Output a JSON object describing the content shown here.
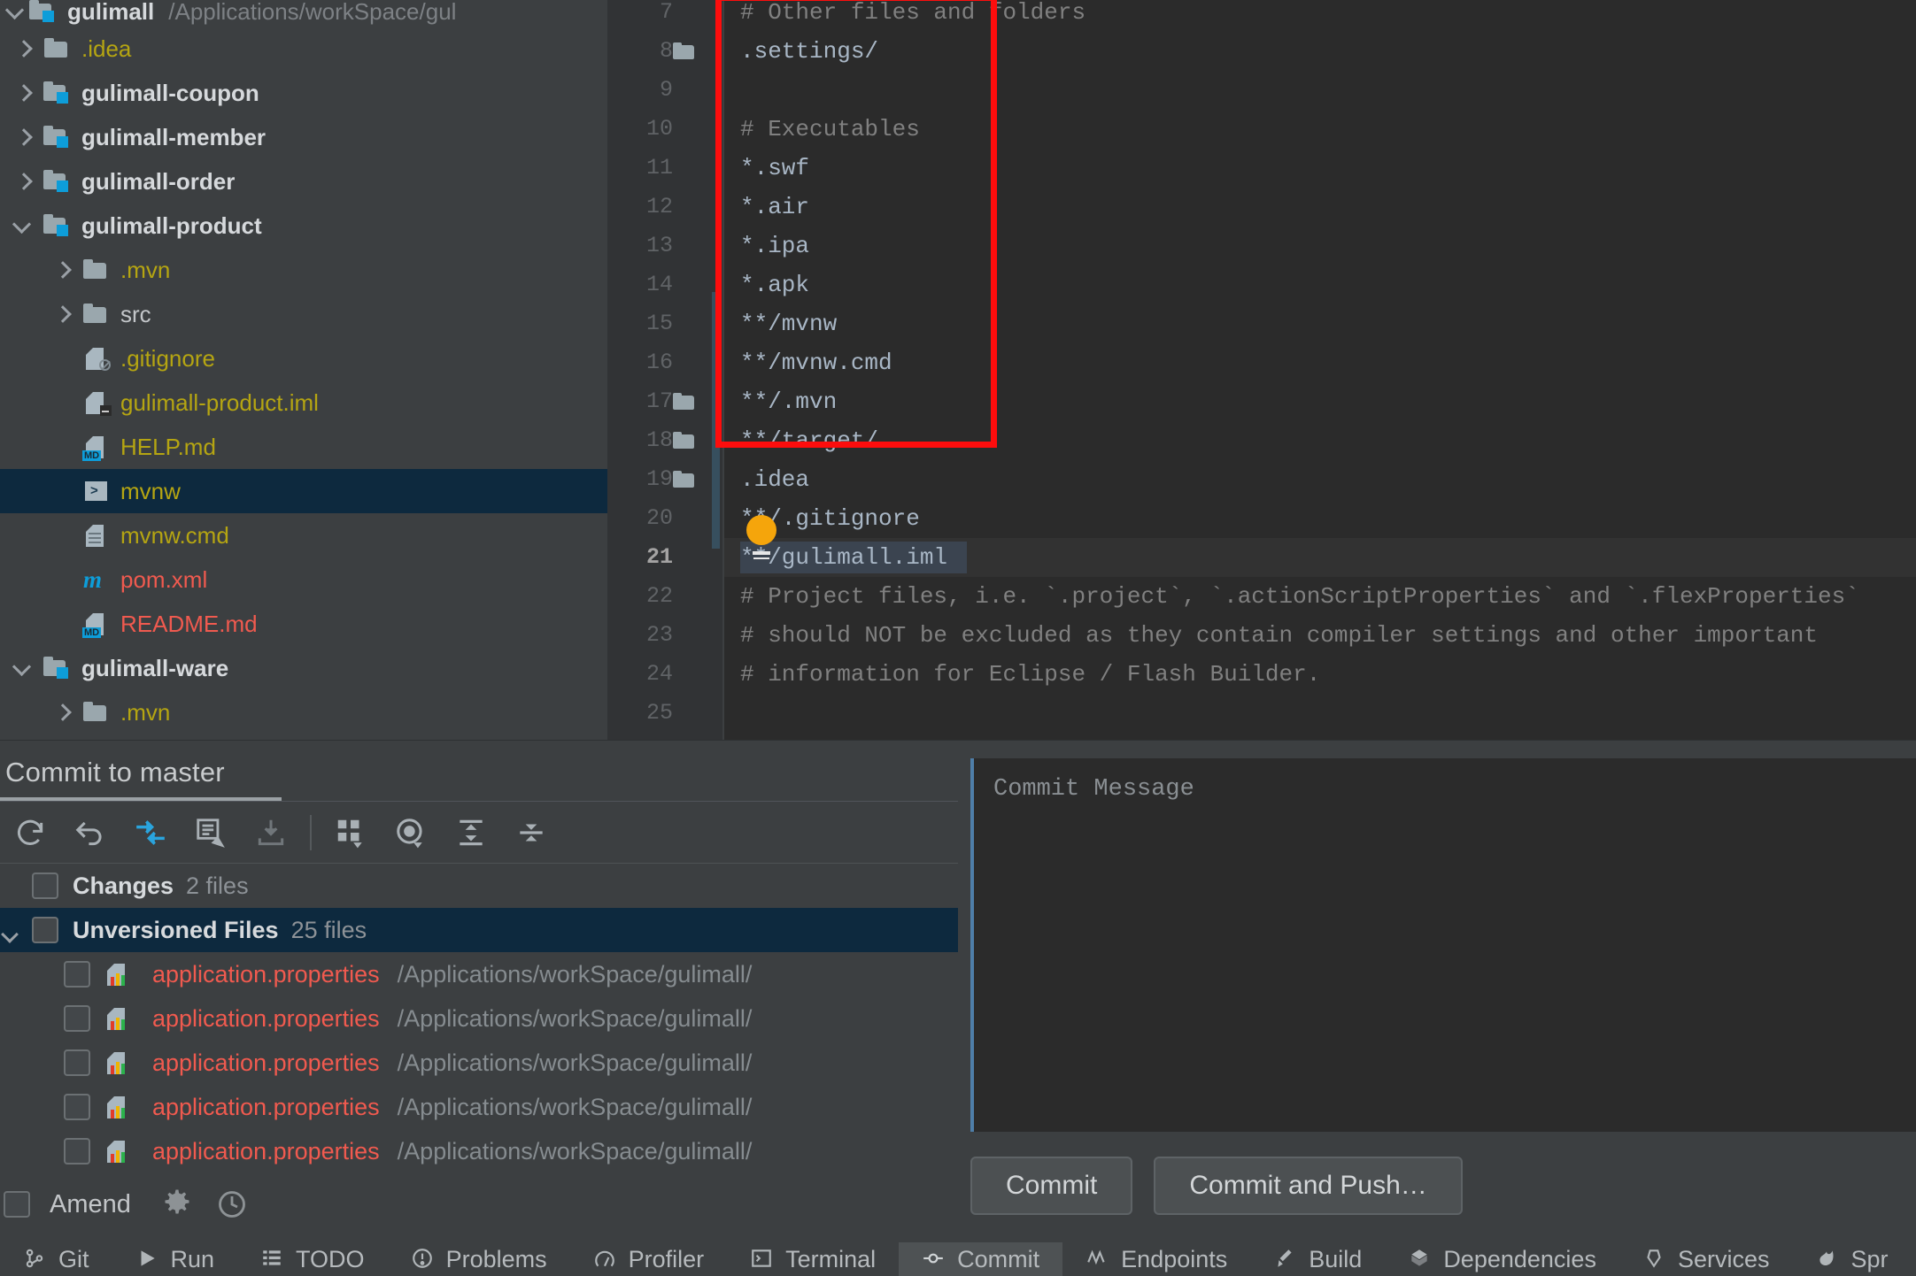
{
  "project": {
    "name": "gulimall",
    "path": "/Applications/workSpace/gul",
    "tree": [
      {
        "label": ".idea",
        "kind": "folder",
        "indent": 1,
        "arrow": "right",
        "color": "yellow",
        "selected": false
      },
      {
        "label": "gulimall-coupon",
        "kind": "module",
        "indent": 1,
        "arrow": "right",
        "color": "bold",
        "selected": false
      },
      {
        "label": "gulimall-member",
        "kind": "module",
        "indent": 1,
        "arrow": "right",
        "color": "bold",
        "selected": false
      },
      {
        "label": "gulimall-order",
        "kind": "module",
        "indent": 1,
        "arrow": "right",
        "color": "bold",
        "selected": false
      },
      {
        "label": "gulimall-product",
        "kind": "module",
        "indent": 1,
        "arrow": "down",
        "color": "bold",
        "selected": false
      },
      {
        "label": ".mvn",
        "kind": "folder",
        "indent": 2,
        "arrow": "right",
        "color": "yellow",
        "selected": false
      },
      {
        "label": "src",
        "kind": "folder",
        "indent": 2,
        "arrow": "right",
        "color": "white",
        "selected": false
      },
      {
        "label": ".gitignore",
        "kind": "gitignore",
        "indent": 2,
        "arrow": "none",
        "color": "yellow",
        "selected": false
      },
      {
        "label": "gulimall-product.iml",
        "kind": "iml",
        "indent": 2,
        "arrow": "none",
        "color": "yellow",
        "selected": false
      },
      {
        "label": "HELP.md",
        "kind": "md",
        "indent": 2,
        "arrow": "none",
        "color": "yellow",
        "selected": false
      },
      {
        "label": "mvnw",
        "kind": "shell",
        "indent": 2,
        "arrow": "none",
        "color": "yellow",
        "selected": true
      },
      {
        "label": "mvnw.cmd",
        "kind": "text",
        "indent": 2,
        "arrow": "none",
        "color": "yellow",
        "selected": false
      },
      {
        "label": "pom.xml",
        "kind": "maven",
        "indent": 2,
        "arrow": "none",
        "color": "red",
        "selected": false
      },
      {
        "label": "README.md",
        "kind": "md",
        "indent": 2,
        "arrow": "none",
        "color": "red",
        "selected": false
      },
      {
        "label": "gulimall-ware",
        "kind": "module",
        "indent": 1,
        "arrow": "down",
        "color": "bold",
        "selected": false
      },
      {
        "label": ".mvn",
        "kind": "folder",
        "indent": 2,
        "arrow": "right",
        "color": "yellow",
        "selected": false
      }
    ]
  },
  "editor": {
    "lines": [
      {
        "num": 7,
        "text": "# Other files and folders",
        "comment": true,
        "fold": false,
        "current": false
      },
      {
        "num": 8,
        "text": ".settings/",
        "comment": false,
        "fold": true,
        "current": false
      },
      {
        "num": 9,
        "text": "",
        "comment": false,
        "fold": false,
        "current": false
      },
      {
        "num": 10,
        "text": "# Executables",
        "comment": true,
        "fold": false,
        "current": false
      },
      {
        "num": 11,
        "text": "*.swf",
        "comment": false,
        "fold": false,
        "current": false
      },
      {
        "num": 12,
        "text": "*.air",
        "comment": false,
        "fold": false,
        "current": false
      },
      {
        "num": 13,
        "text": "*.ipa",
        "comment": false,
        "fold": false,
        "current": false
      },
      {
        "num": 14,
        "text": "*.apk",
        "comment": false,
        "fold": false,
        "current": false
      },
      {
        "num": 15,
        "text": "**/mvnw",
        "comment": false,
        "fold": false,
        "current": false
      },
      {
        "num": 16,
        "text": "**/mvnw.cmd",
        "comment": false,
        "fold": false,
        "current": false
      },
      {
        "num": 17,
        "text": "**/.mvn",
        "comment": false,
        "fold": true,
        "current": false
      },
      {
        "num": 18,
        "text": "**/target/",
        "comment": false,
        "fold": true,
        "current": false
      },
      {
        "num": 19,
        "text": ".idea",
        "comment": false,
        "fold": true,
        "current": false
      },
      {
        "num": 20,
        "text": "**/.gitignore",
        "comment": false,
        "fold": false,
        "current": false
      },
      {
        "num": 21,
        "text": "**/gulimall.iml",
        "comment": false,
        "fold": false,
        "current": true
      },
      {
        "num": 22,
        "text": "# Project files, i.e. `.project`, `.actionScriptProperties` and `.flexProperties`",
        "comment": true,
        "fold": false,
        "current": false
      },
      {
        "num": 23,
        "text": "# should NOT be excluded as they contain compiler settings and other important",
        "comment": true,
        "fold": false,
        "current": false
      },
      {
        "num": 24,
        "text": "# information for Eclipse / Flash Builder.",
        "comment": true,
        "fold": false,
        "current": false
      },
      {
        "num": 25,
        "text": "",
        "comment": false,
        "fold": false,
        "current": false
      }
    ],
    "annotation": {
      "highlight_color": "#fd0d0d",
      "intention_icon": "lightbulb-icon"
    }
  },
  "commit": {
    "title": "Commit to master",
    "toolbar": [
      {
        "name": "refresh-changes-icon"
      },
      {
        "name": "rollback-icon"
      },
      {
        "name": "show-diff-icon"
      },
      {
        "name": "group-by-icon"
      },
      {
        "name": "shelve-silently-icon"
      },
      {
        "name": "group-layout-icon"
      },
      {
        "name": "preview-diff-icon"
      },
      {
        "name": "expand-all-icon"
      },
      {
        "name": "collapse-all-icon"
      }
    ],
    "groups": [
      {
        "label": "Changes",
        "count": "2 files",
        "selected": false,
        "twisty": false
      },
      {
        "label": "Unversioned Files",
        "count": "25 files",
        "selected": true,
        "twisty": true
      }
    ],
    "files": [
      {
        "name": "application.properties",
        "path": "/Applications/workSpace/gulimall/"
      },
      {
        "name": "application.properties",
        "path": "/Applications/workSpace/gulimall/"
      },
      {
        "name": "application.properties",
        "path": "/Applications/workSpace/gulimall/"
      },
      {
        "name": "application.properties",
        "path": "/Applications/workSpace/gulimall/"
      },
      {
        "name": "application.properties",
        "path": "/Applications/workSpace/gulimall/"
      }
    ],
    "amend_label": "Amend",
    "amend_icons": [
      {
        "name": "gear-icon"
      },
      {
        "name": "history-clock-icon"
      }
    ],
    "message_placeholder": "Commit Message",
    "buttons": [
      {
        "label": "Commit",
        "name": "commit-button"
      },
      {
        "label": "Commit and Push…",
        "name": "commit-and-push-button"
      }
    ]
  },
  "statusbar": {
    "items": [
      {
        "label": "Git",
        "icon": "git-icon",
        "active": false
      },
      {
        "label": "Run",
        "icon": "run-icon",
        "active": false
      },
      {
        "label": "TODO",
        "icon": "todo-icon",
        "active": false
      },
      {
        "label": "Problems",
        "icon": "problems-icon",
        "active": false
      },
      {
        "label": "Profiler",
        "icon": "profiler-icon",
        "active": false
      },
      {
        "label": "Terminal",
        "icon": "terminal-icon",
        "active": false
      },
      {
        "label": "Commit",
        "icon": "commit-icon",
        "active": true
      },
      {
        "label": "Endpoints",
        "icon": "endpoints-icon",
        "active": false
      },
      {
        "label": "Build",
        "icon": "build-icon",
        "active": false
      },
      {
        "label": "Dependencies",
        "icon": "dependencies-icon",
        "active": false
      },
      {
        "label": "Services",
        "icon": "services-icon",
        "active": false
      },
      {
        "label": "Spr",
        "icon": "spring-icon",
        "active": false
      }
    ]
  },
  "colors": {
    "accent": "#0d9dd9",
    "selection": "#0d293e",
    "annotation": "#fd0d0d",
    "yellow_file": "#b5a512",
    "red_file": "#f05a4f"
  }
}
